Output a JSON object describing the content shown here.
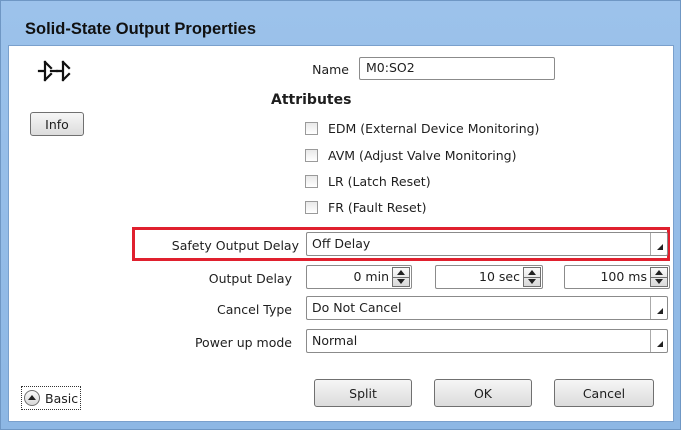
{
  "window": {
    "title": "Solid-State Output Properties"
  },
  "info_button": {
    "label": "Info"
  },
  "name": {
    "label": "Name",
    "value": "M0:SO2"
  },
  "attributes": {
    "heading": "Attributes",
    "checkboxes": [
      {
        "label": "EDM (External Device Monitoring)",
        "checked": false
      },
      {
        "label": "AVM (Adjust Valve Monitoring)",
        "checked": false
      },
      {
        "label": "LR (Latch Reset)",
        "checked": false
      },
      {
        "label": "FR (Fault Reset)",
        "checked": false
      }
    ]
  },
  "safety_output_delay": {
    "label": "Safety Output Delay",
    "value": "Off Delay"
  },
  "output_delay": {
    "label": "Output Delay",
    "min": "0 min",
    "sec": "10 sec",
    "ms": "100 ms"
  },
  "cancel_type": {
    "label": "Cancel Type",
    "value": "Do Not Cancel"
  },
  "power_up_mode": {
    "label": "Power up mode",
    "value": "Normal"
  },
  "buttons": {
    "basic": "Basic",
    "split": "Split",
    "ok": "OK",
    "cancel": "Cancel"
  },
  "colors": {
    "title_bar": "#9cc2eb",
    "highlight": "#e0202e"
  },
  "icons": {
    "element": "solid-state-output-icon",
    "basic_toggle": "chevron-up-icon"
  }
}
